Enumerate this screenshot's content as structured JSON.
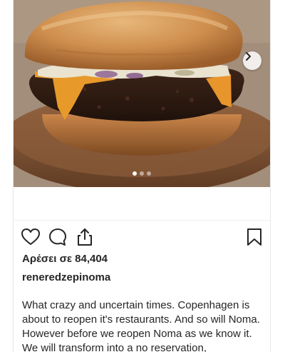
{
  "post": {
    "photo_alt": "cheeseburger",
    "carousel": {
      "total_slides": 3,
      "current_slide": 1
    },
    "likes_text": "Αρέσει σε 84,404",
    "username": "reneredzepinoma",
    "caption": "What crazy and uncertain times. Copenhagen is about to reopen it's restaurants. And so will Noma. However before we reopen Noma as we know it. We will transform into a no reservation,"
  },
  "icons": {
    "like": "heart-icon",
    "comment": "speech-bubble-icon",
    "share": "share-upload-icon",
    "save": "bookmark-icon",
    "next": "chevron-right-icon"
  },
  "colors": {
    "text": "#262626",
    "divider": "#efefef"
  }
}
